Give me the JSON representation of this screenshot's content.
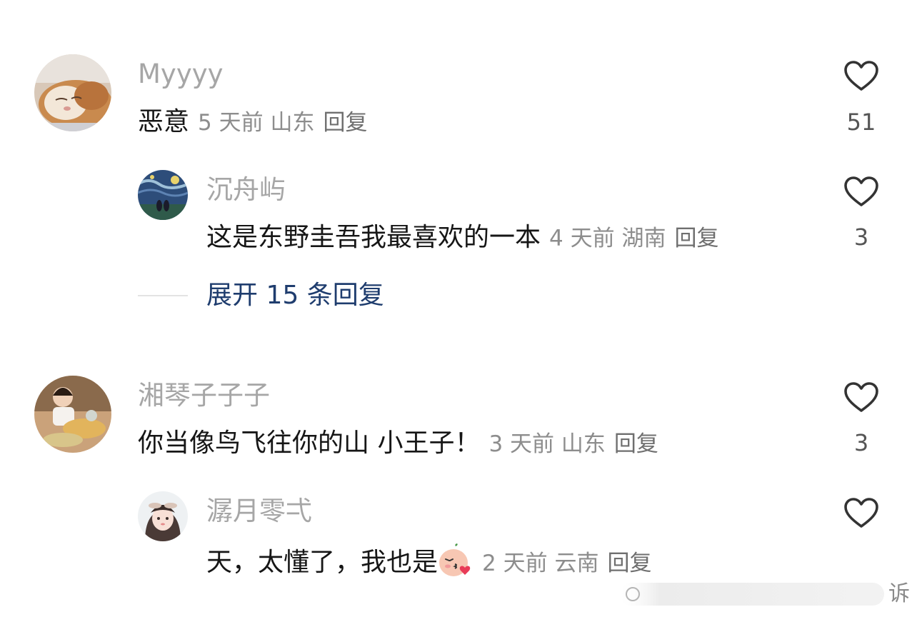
{
  "comments": [
    {
      "username": "Myyyy",
      "text": "恶意",
      "meta": "5 天前 山东",
      "reply_label": "回复",
      "likes": "51",
      "avatar": "cat-avatar",
      "replies": [
        {
          "username": "沉舟屿",
          "text": "这是东野圭吾我最喜欢的一本",
          "meta": "4 天前 湖南",
          "reply_label": "回复",
          "likes": "3",
          "avatar": "starry-night-avatar"
        }
      ],
      "expand_label": "展开 15 条回复"
    },
    {
      "username": "湘琴子子子",
      "text": "你当像鸟飞往你的山  小王子！",
      "meta": "3 天前 山东",
      "reply_label": "回复",
      "likes": "3",
      "avatar": "person-food-avatar",
      "replies": [
        {
          "username": "潺月零弌",
          "text": "天，太懂了，我也是",
          "emoji": "kiss-face-emoji",
          "meta": "2 天前 云南",
          "reply_label": "回复",
          "likes": "",
          "avatar": "anime-girl-avatar"
        }
      ]
    }
  ],
  "watermark": {
    "partial_text": "诉"
  },
  "colors": {
    "username": "#a6a6a6",
    "comment_text": "#161616",
    "meta": "#8d8d8d",
    "expand_link": "#1f3d6e",
    "heart_outline": "#333333"
  }
}
